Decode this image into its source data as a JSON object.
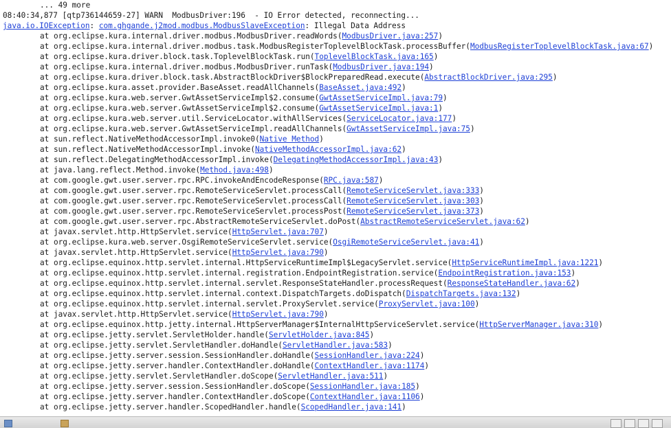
{
  "console": {
    "lines": [
      {
        "kind": "first",
        "prefix": "... 49 more",
        "link": "",
        "suffix": ""
      },
      {
        "kind": "plain",
        "prefix": "08:40:34,877 [qtp736144659-27] WARN  ModbusDriver:196  - IO Error detected, reconnecting...",
        "link": "",
        "suffix": ""
      },
      {
        "kind": "exception",
        "link1": "java.io.IOException",
        "sep": ": ",
        "link2": "com.ghgande.j2mod.modbus.ModbusSlaveException",
        "suffix": ": Illegal Data Address"
      },
      {
        "kind": "frame",
        "prefix": "at org.eclipse.kura.internal.driver.modbus.ModbusDriver.readWords(",
        "link": "ModbusDriver.java:257",
        "suffix": ")"
      },
      {
        "kind": "frame",
        "prefix": "at org.eclipse.kura.internal.driver.modbus.task.ModbusRegisterToplevelBlockTask.processBuffer(",
        "link": "ModbusRegisterToplevelBlockTask.java:67",
        "suffix": ")"
      },
      {
        "kind": "frame",
        "prefix": "at org.eclipse.kura.driver.block.task.ToplevelBlockTask.run(",
        "link": "ToplevelBlockTask.java:165",
        "suffix": ")"
      },
      {
        "kind": "frame",
        "prefix": "at org.eclipse.kura.internal.driver.modbus.ModbusDriver.runTask(",
        "link": "ModbusDriver.java:194",
        "suffix": ")"
      },
      {
        "kind": "frame",
        "prefix": "at org.eclipse.kura.driver.block.task.AbstractBlockDriver$BlockPreparedRead.execute(",
        "link": "AbstractBlockDriver.java:295",
        "suffix": ")"
      },
      {
        "kind": "frame",
        "prefix": "at org.eclipse.kura.asset.provider.BaseAsset.readAllChannels(",
        "link": "BaseAsset.java:492",
        "suffix": ")"
      },
      {
        "kind": "frame",
        "prefix": "at org.eclipse.kura.web.server.GwtAssetServiceImpl$2.consume(",
        "link": "GwtAssetServiceImpl.java:79",
        "suffix": ")"
      },
      {
        "kind": "frame",
        "prefix": "at org.eclipse.kura.web.server.GwtAssetServiceImpl$2.consume(",
        "link": "GwtAssetServiceImpl.java:1",
        "suffix": ")"
      },
      {
        "kind": "frame",
        "prefix": "at org.eclipse.kura.web.server.util.ServiceLocator.withAllServices(",
        "link": "ServiceLocator.java:177",
        "suffix": ")"
      },
      {
        "kind": "frame",
        "prefix": "at org.eclipse.kura.web.server.GwtAssetServiceImpl.readAllChannels(",
        "link": "GwtAssetServiceImpl.java:75",
        "suffix": ")"
      },
      {
        "kind": "frame",
        "prefix": "at sun.reflect.NativeMethodAccessorImpl.invoke0(",
        "link": "Native Method",
        "suffix": ")"
      },
      {
        "kind": "frame",
        "prefix": "at sun.reflect.NativeMethodAccessorImpl.invoke(",
        "link": "NativeMethodAccessorImpl.java:62",
        "suffix": ")"
      },
      {
        "kind": "frame",
        "prefix": "at sun.reflect.DelegatingMethodAccessorImpl.invoke(",
        "link": "DelegatingMethodAccessorImpl.java:43",
        "suffix": ")"
      },
      {
        "kind": "frame",
        "prefix": "at java.lang.reflect.Method.invoke(",
        "link": "Method.java:498",
        "suffix": ")"
      },
      {
        "kind": "frame",
        "prefix": "at com.google.gwt.user.server.rpc.RPC.invokeAndEncodeResponse(",
        "link": "RPC.java:587",
        "suffix": ")"
      },
      {
        "kind": "frame",
        "prefix": "at com.google.gwt.user.server.rpc.RemoteServiceServlet.processCall(",
        "link": "RemoteServiceServlet.java:333",
        "suffix": ")"
      },
      {
        "kind": "frame",
        "prefix": "at com.google.gwt.user.server.rpc.RemoteServiceServlet.processCall(",
        "link": "RemoteServiceServlet.java:303",
        "suffix": ")"
      },
      {
        "kind": "frame",
        "prefix": "at com.google.gwt.user.server.rpc.RemoteServiceServlet.processPost(",
        "link": "RemoteServiceServlet.java:373",
        "suffix": ")"
      },
      {
        "kind": "frame",
        "prefix": "at com.google.gwt.user.server.rpc.AbstractRemoteServiceServlet.doPost(",
        "link": "AbstractRemoteServiceServlet.java:62",
        "suffix": ")"
      },
      {
        "kind": "frame",
        "prefix": "at javax.servlet.http.HttpServlet.service(",
        "link": "HttpServlet.java:707",
        "suffix": ")"
      },
      {
        "kind": "frame",
        "prefix": "at org.eclipse.kura.web.server.OsgiRemoteServiceServlet.service(",
        "link": "OsgiRemoteServiceServlet.java:41",
        "suffix": ")"
      },
      {
        "kind": "frame",
        "prefix": "at javax.servlet.http.HttpServlet.service(",
        "link": "HttpServlet.java:790",
        "suffix": ")"
      },
      {
        "kind": "frame",
        "prefix": "at org.eclipse.equinox.http.servlet.internal.HttpServiceRuntimeImpl$LegacyServlet.service(",
        "link": "HttpServiceRuntimeImpl.java:1221",
        "suffix": ")"
      },
      {
        "kind": "frame",
        "prefix": "at org.eclipse.equinox.http.servlet.internal.registration.EndpointRegistration.service(",
        "link": "EndpointRegistration.java:153",
        "suffix": ")"
      },
      {
        "kind": "frame",
        "prefix": "at org.eclipse.equinox.http.servlet.internal.servlet.ResponseStateHandler.processRequest(",
        "link": "ResponseStateHandler.java:62",
        "suffix": ")"
      },
      {
        "kind": "frame",
        "prefix": "at org.eclipse.equinox.http.servlet.internal.context.DispatchTargets.doDispatch(",
        "link": "DispatchTargets.java:132",
        "suffix": ")"
      },
      {
        "kind": "frame",
        "prefix": "at org.eclipse.equinox.http.servlet.internal.servlet.ProxyServlet.service(",
        "link": "ProxyServlet.java:100",
        "suffix": ")"
      },
      {
        "kind": "frame",
        "prefix": "at javax.servlet.http.HttpServlet.service(",
        "link": "HttpServlet.java:790",
        "suffix": ")"
      },
      {
        "kind": "frame",
        "prefix": "at org.eclipse.equinox.http.jetty.internal.HttpServerManager$InternalHttpServiceServlet.service(",
        "link": "HttpServerManager.java:310",
        "suffix": ")"
      },
      {
        "kind": "frame",
        "prefix": "at org.eclipse.jetty.servlet.ServletHolder.handle(",
        "link": "ServletHolder.java:845",
        "suffix": ")"
      },
      {
        "kind": "frame",
        "prefix": "at org.eclipse.jetty.servlet.ServletHandler.doHandle(",
        "link": "ServletHandler.java:583",
        "suffix": ")"
      },
      {
        "kind": "frame",
        "prefix": "at org.eclipse.jetty.server.session.SessionHandler.doHandle(",
        "link": "SessionHandler.java:224",
        "suffix": ")"
      },
      {
        "kind": "frame",
        "prefix": "at org.eclipse.jetty.server.handler.ContextHandler.doHandle(",
        "link": "ContextHandler.java:1174",
        "suffix": ")"
      },
      {
        "kind": "frame",
        "prefix": "at org.eclipse.jetty.servlet.ServletHandler.doScope(",
        "link": "ServletHandler.java:511",
        "suffix": ")"
      },
      {
        "kind": "frame",
        "prefix": "at org.eclipse.jetty.server.session.SessionHandler.doScope(",
        "link": "SessionHandler.java:185",
        "suffix": ")"
      },
      {
        "kind": "frame",
        "prefix": "at org.eclipse.jetty.server.handler.ContextHandler.doScope(",
        "link": "ContextHandler.java:1106",
        "suffix": ")"
      },
      {
        "kind": "frame",
        "prefix": "at org.eclipse.jetty.server.handler.ScopedHandler.handle(",
        "link": "ScopedHandler.java:141",
        "suffix": ")"
      }
    ]
  },
  "colors": {
    "link": "#1c3fd6",
    "text": "#1a1a1a",
    "background": "#ffffff"
  }
}
